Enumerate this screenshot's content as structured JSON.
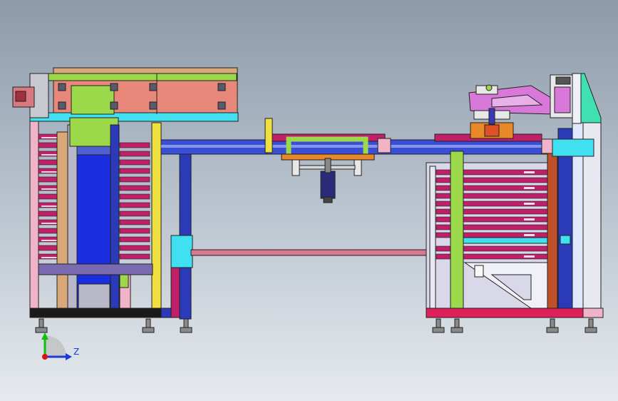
{
  "viewport": {
    "background_top": "#8c9aa9",
    "background_bottom": "#e6eaee"
  },
  "triad": {
    "axis_label": "Z",
    "colors": {
      "x": "#e01010",
      "y": "#10c010",
      "z": "#1a3bd6"
    }
  },
  "palette": {
    "frame_pink": "#f0b4c8",
    "rail_blue": "#3a4fd8",
    "carriage_green": "#9bd84a",
    "plate_salmon": "#e8887a",
    "cyan_plate": "#40e0f0",
    "magenta_stack": "#c0206a",
    "tan_plate": "#d8a878",
    "yellow_post": "#f0e040"
  }
}
